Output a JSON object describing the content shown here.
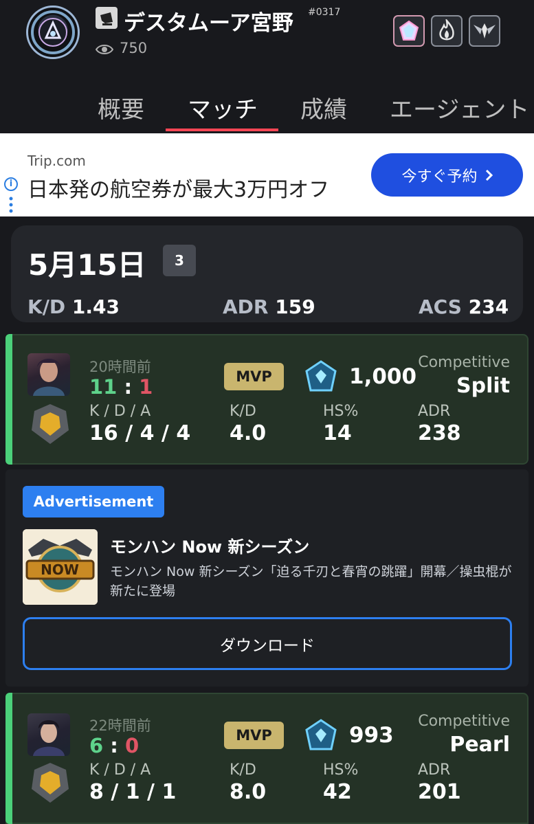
{
  "profile": {
    "name": "デスタムーア宮野",
    "tag": "#0317",
    "views": "750"
  },
  "badges": [
    {
      "icon": "crystal-badge-icon"
    },
    {
      "icon": "flame-badge-icon"
    },
    {
      "icon": "wing-badge-icon"
    }
  ],
  "tabs": [
    "概要",
    "マッチ",
    "成績",
    "エージェント"
  ],
  "active_tab": "マッチ",
  "banner_ad": {
    "source": "Trip.com",
    "headline": "日本発の航空券が最大3万円オフ",
    "cta": "今すぐ予約"
  },
  "day_summary": {
    "date": "5月15日",
    "count": "3",
    "kd_label": "K/D",
    "kd": "1.43",
    "adr_label": "ADR",
    "adr": "159",
    "acs_label": "ACS",
    "acs": "234"
  },
  "matches": [
    {
      "time_ago": "20時間前",
      "score_win": "11",
      "score_loss": "1",
      "mvp": "MVP",
      "level": "1,000",
      "mode": "Competitive",
      "map": "Split",
      "kda_label": "K / D / A",
      "kda": "16 / 4 / 4",
      "kd_label": "K/D",
      "kd": "4.0",
      "hs_label": "HS%",
      "hs": "14",
      "adr_label": "ADR",
      "adr": "238"
    },
    {
      "time_ago": "22時間前",
      "score_win": "6",
      "score_loss": "0",
      "mvp": "MVP",
      "level": "993",
      "mode": "Competitive",
      "map": "Pearl",
      "kda_label": "K / D / A",
      "kda": "8 / 1 / 1",
      "kd_label": "K/D",
      "kd": "8.0",
      "hs_label": "HS%",
      "hs": "42",
      "adr_label": "ADR",
      "adr": "201"
    }
  ],
  "native_ad": {
    "label": "Advertisement",
    "title": "モンハン Now 新シーズン",
    "description": "モンハン Now 新シーズン「迫る千刃と春宵の跳躍」開幕／操虫棍が新たに登場",
    "button": "ダウンロード",
    "thumb_text": "NOW"
  },
  "colors": {
    "background": "#18191d",
    "accent_tab": "#ff4655",
    "win": "#5ed28b",
    "loss": "#e05565",
    "mvp": "#c9b56e",
    "card_bg": "#243226",
    "ad_blue": "#2d7ff0"
  }
}
